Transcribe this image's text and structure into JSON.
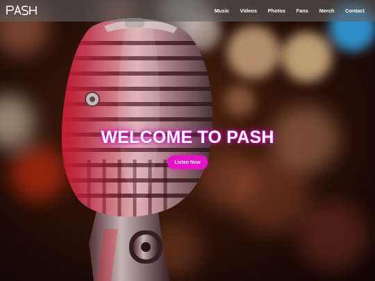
{
  "nav": {
    "logo_text": "PASH",
    "links": [
      {
        "label": "Music"
      },
      {
        "label": "Videos"
      },
      {
        "label": "Photos"
      },
      {
        "label": "Fans"
      },
      {
        "label": "Merch"
      },
      {
        "label": "Contact"
      }
    ]
  },
  "hero": {
    "title": "WELCOME TO PASH",
    "cta_label": "Listen Now",
    "background_image": "vintage-microphone-bokeh-photo"
  },
  "colors": {
    "accent": "#e512c8",
    "title_glow": "#d600be",
    "navbar_bg": "#5f5f5f"
  }
}
